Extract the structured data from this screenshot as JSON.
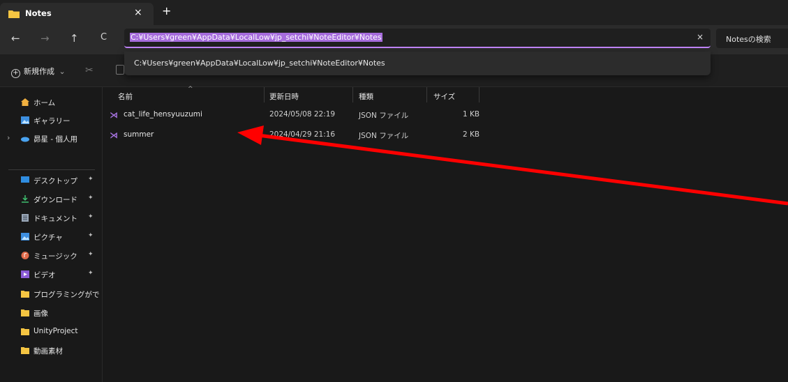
{
  "window": {
    "tab_title": "Notes",
    "tab_close": "×",
    "tab_new": "+"
  },
  "nav": {
    "back": "←",
    "forward": "→",
    "up": "↑",
    "refresh": "C"
  },
  "address": {
    "value": "C:¥Users¥green¥AppData¥LocalLow¥jp_setchi¥NoteEditor¥Notes",
    "clear": "×",
    "suggestion": "C:¥Users¥green¥AppData¥LocalLow¥jp_setchi¥NoteEditor¥Notes"
  },
  "search": {
    "label": "Notesの検索"
  },
  "commandbar": {
    "new_label": "新規作成",
    "new_chevron": "⌄"
  },
  "sidebar": {
    "items": [
      {
        "label": "ホーム",
        "icon": "home-icon",
        "color": "#f0b040"
      },
      {
        "label": "ギャラリー",
        "icon": "gallery-icon",
        "color": "#3d8fe0"
      },
      {
        "label": "昴星 - 個人用",
        "icon": "onedrive-icon",
        "color": "#4aa3f0"
      },
      {
        "label": "デスクトップ",
        "icon": "desktop-icon",
        "color": "#2f8de0",
        "pinned": true
      },
      {
        "label": "ダウンロード",
        "icon": "download-icon",
        "color": "#3fbf6f",
        "pinned": true
      },
      {
        "label": "ドキュメント",
        "icon": "document-icon",
        "color": "#9aa7b8",
        "pinned": true
      },
      {
        "label": "ピクチャ",
        "icon": "pictures-icon",
        "color": "#3d8fe0",
        "pinned": true
      },
      {
        "label": "ミュージック",
        "icon": "music-icon",
        "color": "#e06a4a",
        "pinned": true
      },
      {
        "label": "ビデオ",
        "icon": "video-icon",
        "color": "#8b5cd6",
        "pinned": true
      },
      {
        "label": "プログラミングができる人",
        "icon": "folder-icon",
        "color": "#f5c542"
      },
      {
        "label": "画像",
        "icon": "folder-icon",
        "color": "#f5c542"
      },
      {
        "label": "UnityProject",
        "icon": "folder-icon",
        "color": "#f5c542"
      },
      {
        "label": "動画素材",
        "icon": "folder-icon",
        "color": "#f5c542"
      }
    ],
    "pin_glyph": "📌"
  },
  "filelist": {
    "columns": [
      "名前",
      "更新日時",
      "種類",
      "サイズ"
    ],
    "rows": [
      {
        "name": "cat_life_hensyuuzumi",
        "modified": "2024/05/08 22:19",
        "type": "JSON ファイル",
        "size": "1 KB"
      },
      {
        "name": "summer",
        "modified": "2024/04/29 21:16",
        "type": "JSON ファイル",
        "size": "2 KB"
      }
    ]
  },
  "colors": {
    "accent": "#c084fc",
    "selection": "#a66cdc",
    "annotation_arrow": "#ff0000"
  }
}
